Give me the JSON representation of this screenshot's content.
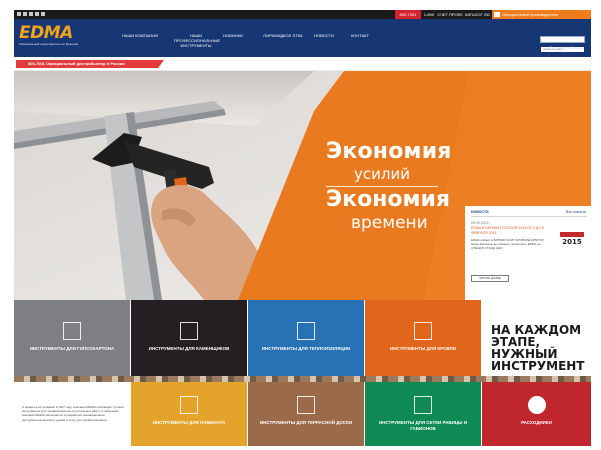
{
  "header": {
    "top_buttons": [
      "800-7001",
      "1-800",
      "СЧЕТ ПРОЕК",
      "КАТАЛОГ 2020",
      "Официальный производитель"
    ],
    "logo_text": "EDMA",
    "logo_subtitle": "Официальный представитель во Франции",
    "nav": [
      "НАШИ КОМПАНИИ",
      "НАШИ ПРОФЕССИОНАЛЬНЫЕ ИНСТРУМЕНТЫ",
      "НОВИНКИ",
      "ПИРАМИДКОЛ ЭТКА",
      "НОВОСТИ",
      "КОНТАКТ"
    ],
    "search_placeholder": "поиск по сайту",
    "search_link": "Расширенный поиск"
  },
  "banner": {
    "promo": "800-7001 Официальный дистрибьютор в России"
  },
  "hero": {
    "line1": "Экономия",
    "line2": "усилий",
    "line3": "Экономия",
    "line4": "времени"
  },
  "news": {
    "heading": "НОВОСТИ",
    "all": "Все новости",
    "date": "05.09.2015",
    "title": "EDMA В БАТИМАТ РОССИЯ 2015 ОТ 2 ДО 6 ФЕВРАЛЯ 2015",
    "body": "EDMA примет в BATIMAT 2015 ГОЛОВ RELOPMYNT. Наши филиалы вы сможете посмотреть EDMA на СТЕНД В СТАНД 1320",
    "expo_year": "2015",
    "button": "ЧИТАТЬ ДАЛЕЕ"
  },
  "tiles": [
    {
      "label": "ИНСТРУМЕНТЫ ДЛЯ ГИПСОКАРТОНА",
      "color": "#7d7f82"
    },
    {
      "label": "ИНСТРУМЕНТЫ ДЛЯ КАМЕНЩИКОВ",
      "color": "#231f22"
    },
    {
      "label": "ИНСТРУМЕНТЫ ДЛЯ ТЕПЛОИЗОЛЯЦИИ",
      "color": "#2771b4"
    },
    {
      "label": "ИНСТРУМЕНТЫ ДЛЯ КРОВЛИ",
      "color": "#e0661c"
    },
    {
      "label": "ИНСТРУМЕНТЫ ДЛЯ ЛАМИНАТА",
      "color": "#e4a32a"
    },
    {
      "label": "ИНСТРУМЕНТЫ ДЛЯ ТЕРРАСНОЙ ДОСКИ",
      "color": "#9b6a4a"
    },
    {
      "label": "ИНСТРУМЕНТЫ ДЛЯ СЕТКИ РАБИЦЫ И ГАБИОНОВ",
      "color": "#0f8a55"
    },
    {
      "label": "РАСХОДНИКИ",
      "color": "#c0272d"
    }
  ],
  "slogan": "НА КАЖДОМ\nЭТАПЕ,\nНУЖНЫЙ\nИНСТРУМЕНТ",
  "about": "С момента её создания в 1927 году, компания EDMA производит ручные инструменты для профессионалов строительных работ. Стремление компании EDMA заключается в разработке инновационных инструментов высокого уровня и услуг для профессионалов."
}
